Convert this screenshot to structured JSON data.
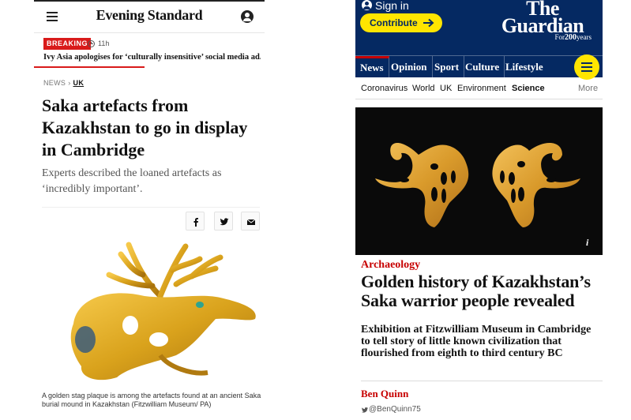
{
  "evening_standard": {
    "logo": "Evening Standard",
    "breaking_label": "BREAKING",
    "breaking_time": "11h",
    "breaking_headline": "Ivy Asia apologises for ‘culturally insensitive’ social media ad...",
    "breadcrumb": {
      "section": "NEWS",
      "subsection": "UK"
    },
    "headline": "Saka artefacts from Kazakhstan to go in display in Cambridge",
    "standfirst": "Experts described the loaned artefacts as ‘incredibly important’.",
    "share_icons": [
      "facebook-icon",
      "twitter-icon",
      "email-icon"
    ],
    "caption": "A golden stag plaque is among the artefacts found at an ancient Saka burial mound in Kazakhstan (Fitzwilliam Museum/ PA)",
    "colors": {
      "breaking": "#d91a1a",
      "text": "#111111"
    }
  },
  "guardian": {
    "sign_in": "Sign in",
    "contribute": "Contribute",
    "logo_line1": "The",
    "logo_line2": "Guardian",
    "logo_sub_prefix": "For",
    "logo_sub_number": "200",
    "logo_sub_suffix": "years",
    "pillars": [
      "News",
      "Opinion",
      "Sport",
      "Culture",
      "Lifestyle"
    ],
    "subnav": [
      "Coronavirus",
      "World",
      "UK",
      "Environment",
      "Science"
    ],
    "subnav_more": "More",
    "kicker": "Archaeology",
    "headline": "Golden history of Kazakhstan’s Saka warrior people revealed",
    "standfirst": "Exhibition at Fitzwilliam Museum in Cambridge to tell story of little known civilization that flourished from eighth to third century BC",
    "byline": "Ben Quinn",
    "twitter_handle": "@BenQuinn75",
    "image_info": "i",
    "colors": {
      "brand": "#052962",
      "accent": "#ffe500",
      "news": "#c70000"
    }
  }
}
